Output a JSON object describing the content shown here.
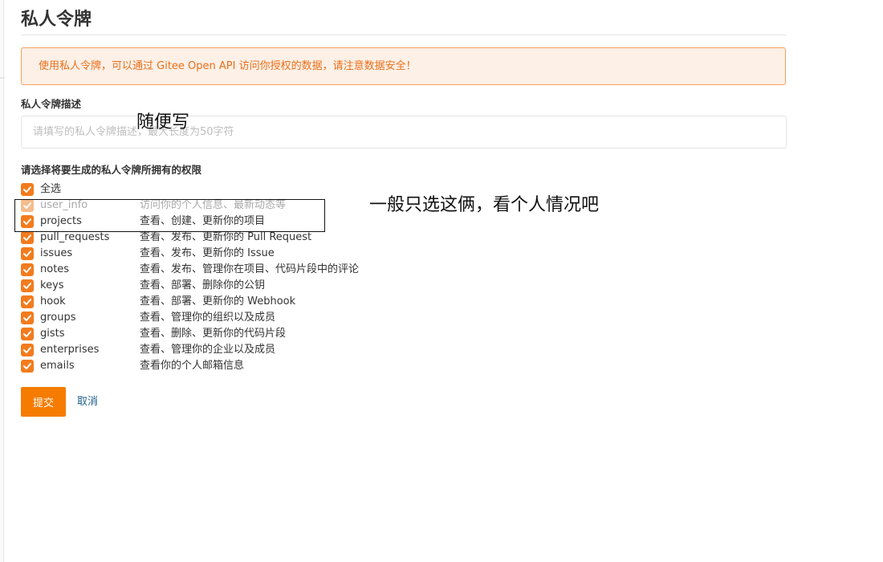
{
  "page": {
    "title": "私人令牌",
    "notice": "使用私人令牌，可以通过 Gitee Open API 访问你授权的数据，请注意数据安全！"
  },
  "description": {
    "label": "私人令牌描述",
    "placeholder": "请填写的私人令牌描述，最大长度为50字符",
    "value": ""
  },
  "permissions": {
    "label": "请选择将要生成的私人令牌所拥有的权限",
    "select_all": {
      "label": "全选",
      "checked": true
    },
    "items": [
      {
        "name": "user_info",
        "desc": "访问你的个人信息、最新动态等",
        "checked": true,
        "disabled": true
      },
      {
        "name": "projects",
        "desc": "查看、创建、更新你的项目",
        "checked": true,
        "disabled": false
      },
      {
        "name": "pull_requests",
        "desc": "查看、发布、更新你的 Pull Request",
        "checked": true,
        "disabled": false
      },
      {
        "name": "issues",
        "desc": "查看、发布、更新你的 Issue",
        "checked": true,
        "disabled": false
      },
      {
        "name": "notes",
        "desc": "查看、发布、管理你在项目、代码片段中的评论",
        "checked": true,
        "disabled": false
      },
      {
        "name": "keys",
        "desc": "查看、部署、删除你的公钥",
        "checked": true,
        "disabled": false
      },
      {
        "name": "hook",
        "desc": "查看、部署、更新你的 Webhook",
        "checked": true,
        "disabled": false
      },
      {
        "name": "groups",
        "desc": "查看、管理你的组织以及成员",
        "checked": true,
        "disabled": false
      },
      {
        "name": "gists",
        "desc": "查看、删除、更新你的代码片段",
        "checked": true,
        "disabled": false
      },
      {
        "name": "enterprises",
        "desc": "查看、管理你的企业以及成员",
        "checked": true,
        "disabled": false
      },
      {
        "name": "emails",
        "desc": "查看你的个人邮箱信息",
        "checked": true,
        "disabled": false
      }
    ]
  },
  "actions": {
    "submit_label": "提交",
    "cancel_label": "取消"
  },
  "annotations": {
    "description_note": "随便写",
    "permission_note": "一般只选这俩，看个人情况吧"
  },
  "colors": {
    "accent": "#f37b1d",
    "accent_disabled": "#f6bc8d",
    "notice_bg": "#fdf0e6",
    "notice_border": "#f4a161",
    "notice_text": "#e96f1b",
    "link": "#1d5e8c"
  },
  "icons": {
    "checkbox": "check-icon"
  }
}
